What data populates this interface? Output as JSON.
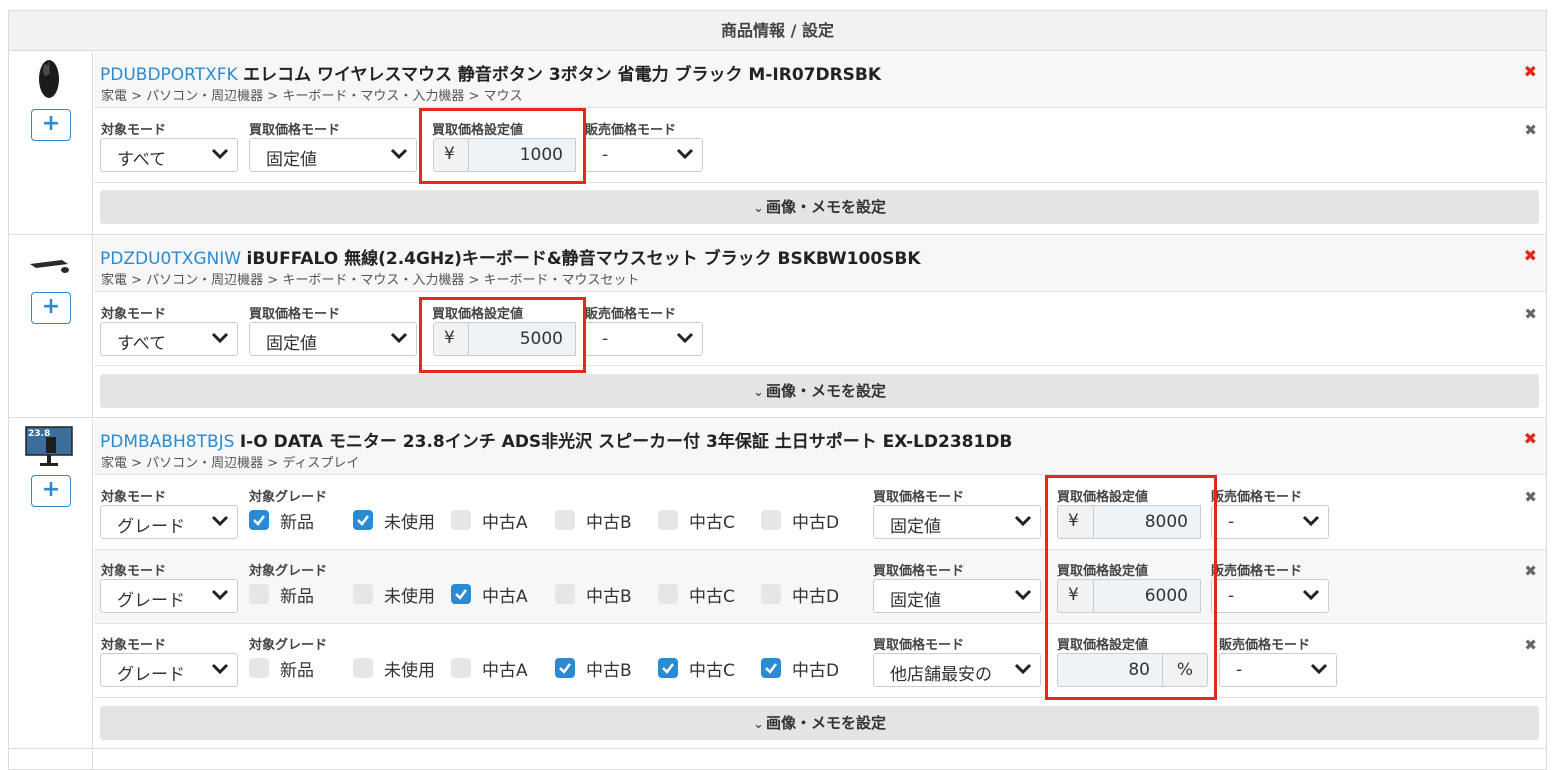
{
  "header": {
    "title": "商品情報 / 設定"
  },
  "labels": {
    "target_mode": "対象モード",
    "target_grade": "対象グレード",
    "buy_mode": "買取価格モード",
    "buy_value": "買取価格設定値",
    "sell_mode": "販売価格モード",
    "memo_button": "画像・メモを設定",
    "yen": "¥",
    "percent": "%",
    "add": "+",
    "delete": "✖"
  },
  "grades": [
    "新品",
    "未使用",
    "中古A",
    "中古B",
    "中古C",
    "中古D"
  ],
  "colors": {
    "accent": "#2a8bd3",
    "delete": "#e0281d",
    "highlight": "#e5281c"
  },
  "products": [
    {
      "code": "PDUBDPORTXFK",
      "name": "エレコム ワイヤレスマウス 静音ボタン 3ボタン 省電力 ブラック M-IR07DRSBK",
      "breadcrumb": "家電 > パソコン・周辺機器 > キーボード・マウス・入力機器 > マウス",
      "thumbnail_icon": "mouse-thumbnail",
      "rules": [
        {
          "target_mode": "すべて",
          "buy_mode": "固定値",
          "buy_value": "1000",
          "sell_mode": "-"
        }
      ]
    },
    {
      "code": "PDZDU0TXGNIW",
      "name": "iBUFFALO 無線(2.4GHz)キーボード&静音マウスセット ブラック BSKBW100SBK",
      "breadcrumb": "家電 > パソコン・周辺機器 > キーボード・マウス・入力機器 > キーボード・マウスセット",
      "thumbnail_icon": "keyboard-thumbnail",
      "rules": [
        {
          "target_mode": "すべて",
          "buy_mode": "固定値",
          "buy_value": "5000",
          "sell_mode": "-"
        }
      ]
    },
    {
      "code": "PDMBABH8TBJS",
      "name": "I-O DATA モニター 23.8インチ ADS非光沢 スピーカー付 3年保証 土日サポート EX-LD2381DB",
      "breadcrumb": "家電 > パソコン・周辺機器 > ディスプレイ",
      "thumbnail_icon": "monitor-thumbnail",
      "thumbnail_text": "23.8",
      "rules": [
        {
          "target_mode": "グレード",
          "grades_checked": [
            true,
            true,
            false,
            false,
            false,
            false
          ],
          "buy_mode": "固定値",
          "buy_value": "8000",
          "sell_mode": "-"
        },
        {
          "target_mode": "グレード",
          "grades_checked": [
            false,
            false,
            true,
            false,
            false,
            false
          ],
          "buy_mode": "固定値",
          "buy_value": "6000",
          "sell_mode": "-"
        },
        {
          "target_mode": "グレード",
          "grades_checked": [
            false,
            false,
            false,
            true,
            true,
            true
          ],
          "buy_mode": "他店舗最安の",
          "buy_value": "80",
          "sell_mode": "-"
        }
      ]
    }
  ]
}
